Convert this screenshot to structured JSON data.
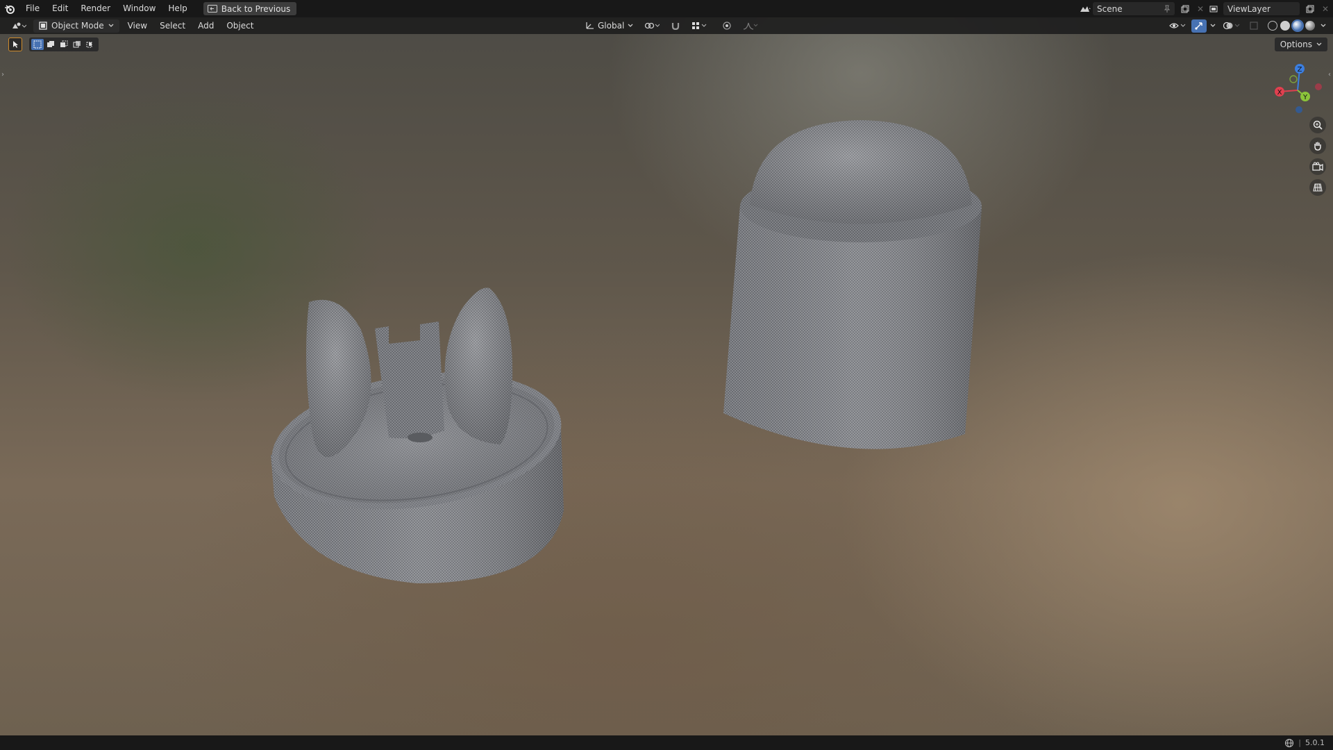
{
  "topbar": {
    "menus": [
      "File",
      "Edit",
      "Render",
      "Window",
      "Help"
    ],
    "back_label": "Back to Previous",
    "scene_name": "Scene",
    "view_layer": "ViewLayer"
  },
  "header": {
    "mode": "Object Mode",
    "menus": [
      "View",
      "Select",
      "Add",
      "Object"
    ],
    "transform_orientation": "Global"
  },
  "toolbar": {
    "options_label": "Options"
  },
  "gizmo": {
    "axis_z": "Z",
    "axis_x": "X",
    "axis_y": "Y"
  },
  "status": {
    "version": "5.0.1"
  },
  "colors": {
    "axis_x": "#e0404f",
    "axis_y": "#8bc43a",
    "axis_z": "#3b7ee0",
    "accent": "#4772b3"
  }
}
